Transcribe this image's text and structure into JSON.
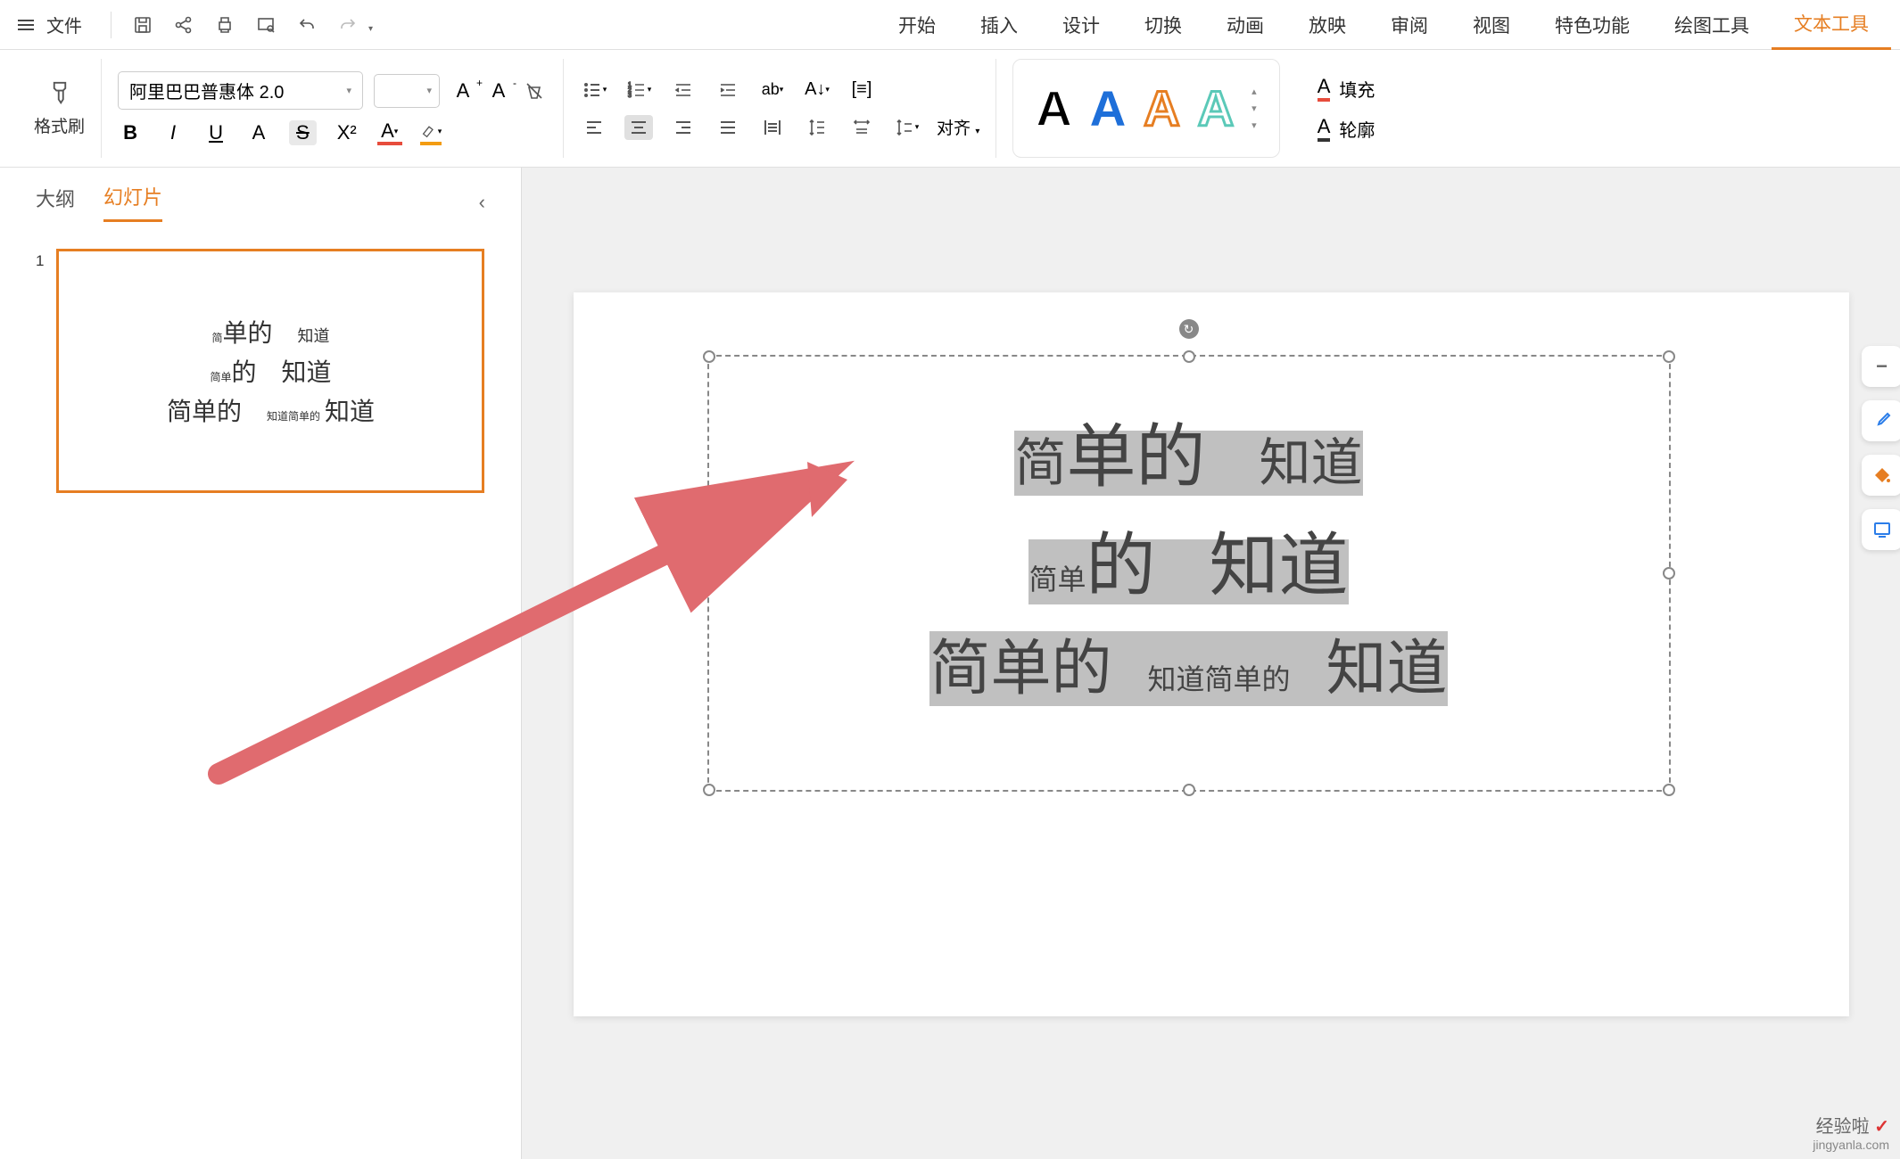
{
  "menu": {
    "file": "文件",
    "tabs": [
      "开始",
      "插入",
      "设计",
      "切换",
      "动画",
      "放映",
      "审阅",
      "视图",
      "特色功能",
      "绘图工具",
      "文本工具"
    ],
    "activeTab": "文本工具"
  },
  "ribbon": {
    "formatBrush": "格式刷",
    "fontName": "阿里巴巴普惠体 2.0",
    "fontSize": "",
    "align": "对齐",
    "fill": "填充",
    "outline": "轮廓"
  },
  "sidebar": {
    "tabOutline": "大纲",
    "tabSlides": "幻灯片",
    "activeTab": "幻灯片",
    "slideNum": "1",
    "thumbLines": {
      "l1_simple_sm": "简",
      "l1_simple_lg": "单的",
      "l1_know": "知道",
      "l2_simple_tiny": "简单",
      "l2_de": "的",
      "l2_know": "知道",
      "l3_simple": "简单的",
      "l3_zdjdd": "知道简单的",
      "l3_know": "知道"
    }
  },
  "canvas": {
    "line1": {
      "jian": "简",
      "dande": "单的",
      "zhidao": "知道"
    },
    "line2": {
      "jiandan": "简单",
      "de": "的",
      "zhidao": "知道"
    },
    "line3": {
      "jiandande": "简单的",
      "zdjdd": "知道简单的",
      "zhidao": "知道"
    }
  },
  "watermark": {
    "brand": "经验啦",
    "domain": "jingyanla.com"
  }
}
